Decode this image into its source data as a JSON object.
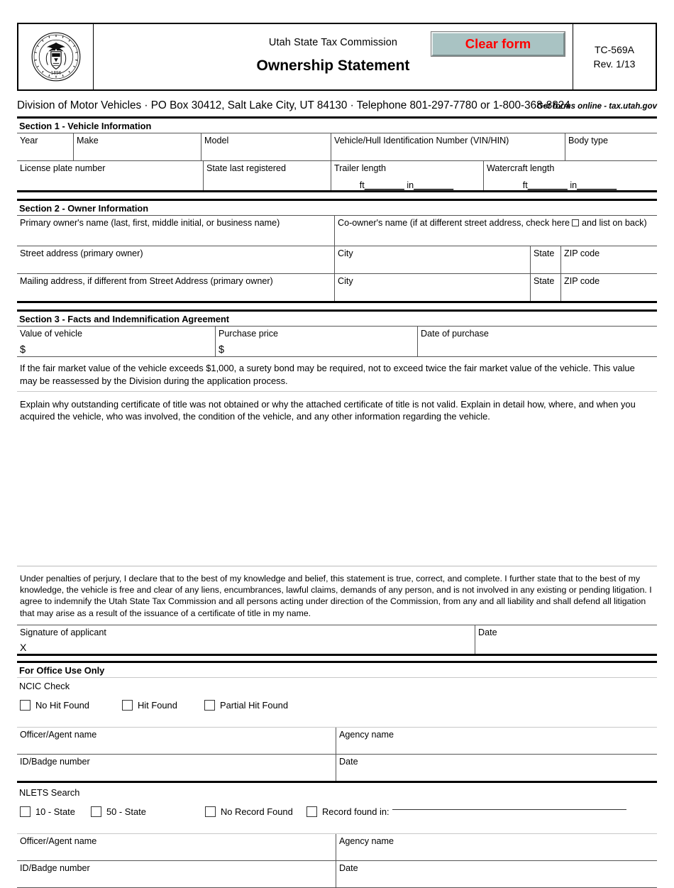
{
  "header": {
    "seal_icon": "utah-state-seal-icon",
    "seal_text_outer": "THE GREAT SEAL OF THE STATE OF UTAH",
    "seal_year": "1896",
    "agency": "Utah State Tax Commission",
    "title": "Ownership Statement",
    "clear_form_label": "Clear form",
    "clear_form_bg": "#a9c3c3",
    "clear_form_color": "#ff0000",
    "form_number": "TC-569A",
    "revision": "Rev. 1/13"
  },
  "address_line": {
    "division": "Division of Motor Vehicles · PO Box 30412, Salt Lake City, UT 84130 · Telephone 801-297-7780 or 1-800-368-8824",
    "get_forms": "Get forms online - tax.utah.gov"
  },
  "section1": {
    "heading": "Section 1 - Vehicle Information",
    "row1": {
      "year": "Year",
      "make": "Make",
      "model": "Model",
      "vin": "Vehicle/Hull Identification Number (VIN/HIN)",
      "body_type": "Body type"
    },
    "row2": {
      "license_plate": "License plate number",
      "state_last_registered": "State last registered",
      "trailer_length": "Trailer length",
      "watercraft_length": "Watercraft length",
      "ft_label": "ft",
      "in_label": "in",
      "blank_rule": "________"
    }
  },
  "section2": {
    "heading": "Section 2 - Owner Information",
    "row1": {
      "primary_owner": "Primary owner's name (last, first, middle initial, or business name)",
      "coowner_pre": "Co-owner's name (if at different street address, check here",
      "coowner_post": "and list on back)"
    },
    "row2": {
      "street_address": "Street address (primary owner)",
      "city": "City",
      "state": "State",
      "zip": "ZIP code"
    },
    "row3": {
      "mailing_address": "Mailing address, if different from Street Address (primary owner)",
      "city": "City",
      "state": "State",
      "zip": "ZIP code"
    }
  },
  "section3": {
    "heading": "Section 3 - Facts and Indemnification Agreement",
    "value_of_vehicle": "Value of vehicle",
    "purchase_price": "Purchase price",
    "date_of_purchase": "Date of purchase",
    "dollar_sign": "$",
    "surety_note": "If the fair market value of the vehicle exceeds $1,000, a surety bond may be required, not to exceed twice the fair market value of the vehicle. This value may be reassessed by the Division during the application process.",
    "explain_prompt": "Explain why outstanding certificate of title was not obtained or why the attached certificate of title is not valid. Explain in detail how, where, and when you acquired the vehicle, who was involved, the condition of the vehicle, and any other information regarding the vehicle."
  },
  "perjury": {
    "text": "Under penalties of perjury, I declare that to the best of my knowledge and belief, this statement is true, correct, and complete. I further state that to the best of my knowledge, the vehicle is free and clear of any liens, encumbrances, lawful claims, demands of any person, and is not involved in any existing or pending litigation.  I agree to indemnify the Utah State Tax Commission and all persons acting under direction of the Commission, from any and all liability and shall defend all litigation that may arise as a result of the issuance of a certificate of title in my name."
  },
  "signature": {
    "label": "Signature of applicant",
    "x_mark": "X",
    "date_label": "Date"
  },
  "office_use": {
    "heading": "For Office Use Only",
    "ncic": {
      "label": "NCIC Check",
      "checkboxes": [
        {
          "label": "No Hit Found"
        },
        {
          "label": "Hit Found"
        },
        {
          "label": "Partial Hit Found"
        }
      ],
      "officer_name": "Officer/Agent name",
      "agency_name": "Agency name",
      "id_badge": "ID/Badge number",
      "date": "Date"
    },
    "nlets": {
      "label": "NLETS Search",
      "checkboxes": [
        {
          "label": "10 - State"
        },
        {
          "label": "50 - State"
        },
        {
          "label": "No Record Found"
        },
        {
          "label": "Record found in:"
        }
      ],
      "officer_name": "Officer/Agent name",
      "agency_name": "Agency name",
      "id_badge": "ID/Badge number",
      "date": "Date"
    }
  }
}
